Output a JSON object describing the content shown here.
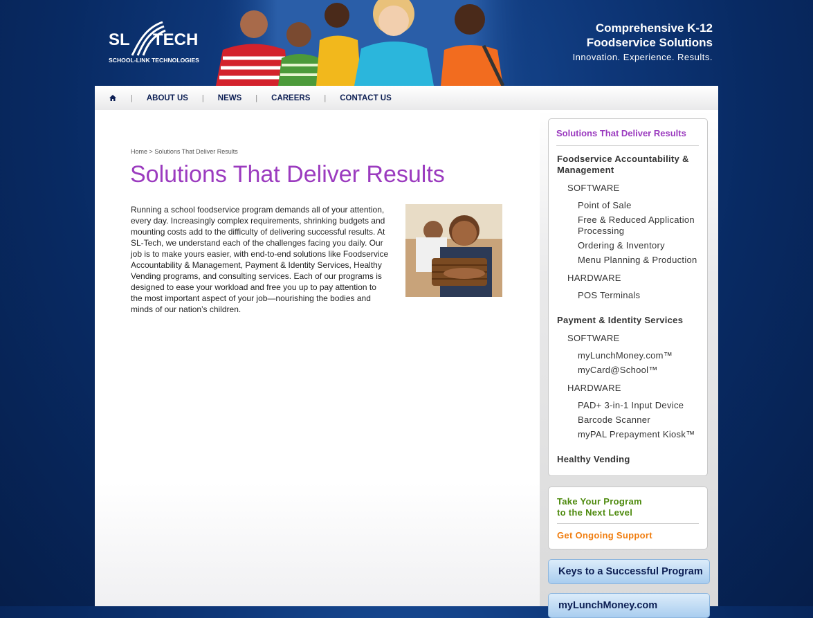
{
  "header": {
    "logo_main_left": "SL",
    "logo_main_right": "TECH",
    "logo_sub": "SCHOOL-LINK TECHNOLOGIES",
    "tagline_line1": "Comprehensive K-12",
    "tagline_line2": "Foodservice Solutions",
    "tagline_line3": "Innovation. Experience. Results."
  },
  "nav": {
    "home_icon": "home-icon",
    "items": [
      {
        "label": "ABOUT US"
      },
      {
        "label": "NEWS"
      },
      {
        "label": "CAREERS"
      },
      {
        "label": "CONTACT US"
      }
    ],
    "separator": "|"
  },
  "breadcrumb": {
    "home": "Home",
    "sep": ">",
    "current": "Solutions That Deliver Results"
  },
  "main": {
    "title": "Solutions That Deliver Results",
    "body": "Running a school foodservice program demands all of your attention, every day. Increasingly complex requirements, shrinking budgets and mounting costs add to the difficulty of delivering successful results. At SL-Tech, we understand each of the challenges facing you daily. Our job is to make yours easier, with end-to-end solutions like Foodservice Accountability & Management, Payment & Identity Services, Healthy Vending programs, and consulting services. Each of our programs is designed to ease your workload and free you up to pay attention to the most important aspect of your job—nourishing the bodies and minds of our nation’s children."
  },
  "sidebar": {
    "title": "Solutions That Deliver Results",
    "sections": [
      {
        "label": "Foodservice Accountability & Management",
        "groups": [
          {
            "label": "SOFTWARE",
            "items": [
              "Point of Sale",
              "Free & Reduced Application Processing",
              "Ordering & Inventory",
              "Menu Planning & Production"
            ]
          },
          {
            "label": "HARDWARE",
            "items": [
              "POS Terminals"
            ]
          }
        ]
      },
      {
        "label": "Payment & Identity Services",
        "groups": [
          {
            "label": "SOFTWARE",
            "items": [
              "myLunchMoney.com™",
              "myCard@School™"
            ]
          },
          {
            "label": "HARDWARE",
            "items": [
              "PAD+ 3-in-1 Input Device",
              "Barcode Scanner",
              "myPAL Prepayment Kiosk™"
            ]
          }
        ]
      },
      {
        "label": "Healthy Vending",
        "groups": []
      }
    ],
    "promo_green": "Take Your Program to the Next Level",
    "promo_green_l1": "Take Your Program",
    "promo_green_l2": "to the Next Level",
    "promo_orange": "Get Ongoing Support",
    "button1": "Keys to a Successful Program",
    "button2": "myLunchMoney.com"
  },
  "colors": {
    "accent_purple": "#9b3bbf",
    "nav_text": "#0d1f54",
    "promo_green": "#4e8a0e",
    "promo_orange": "#f07d0f",
    "bg_blue": "#0e3779"
  }
}
